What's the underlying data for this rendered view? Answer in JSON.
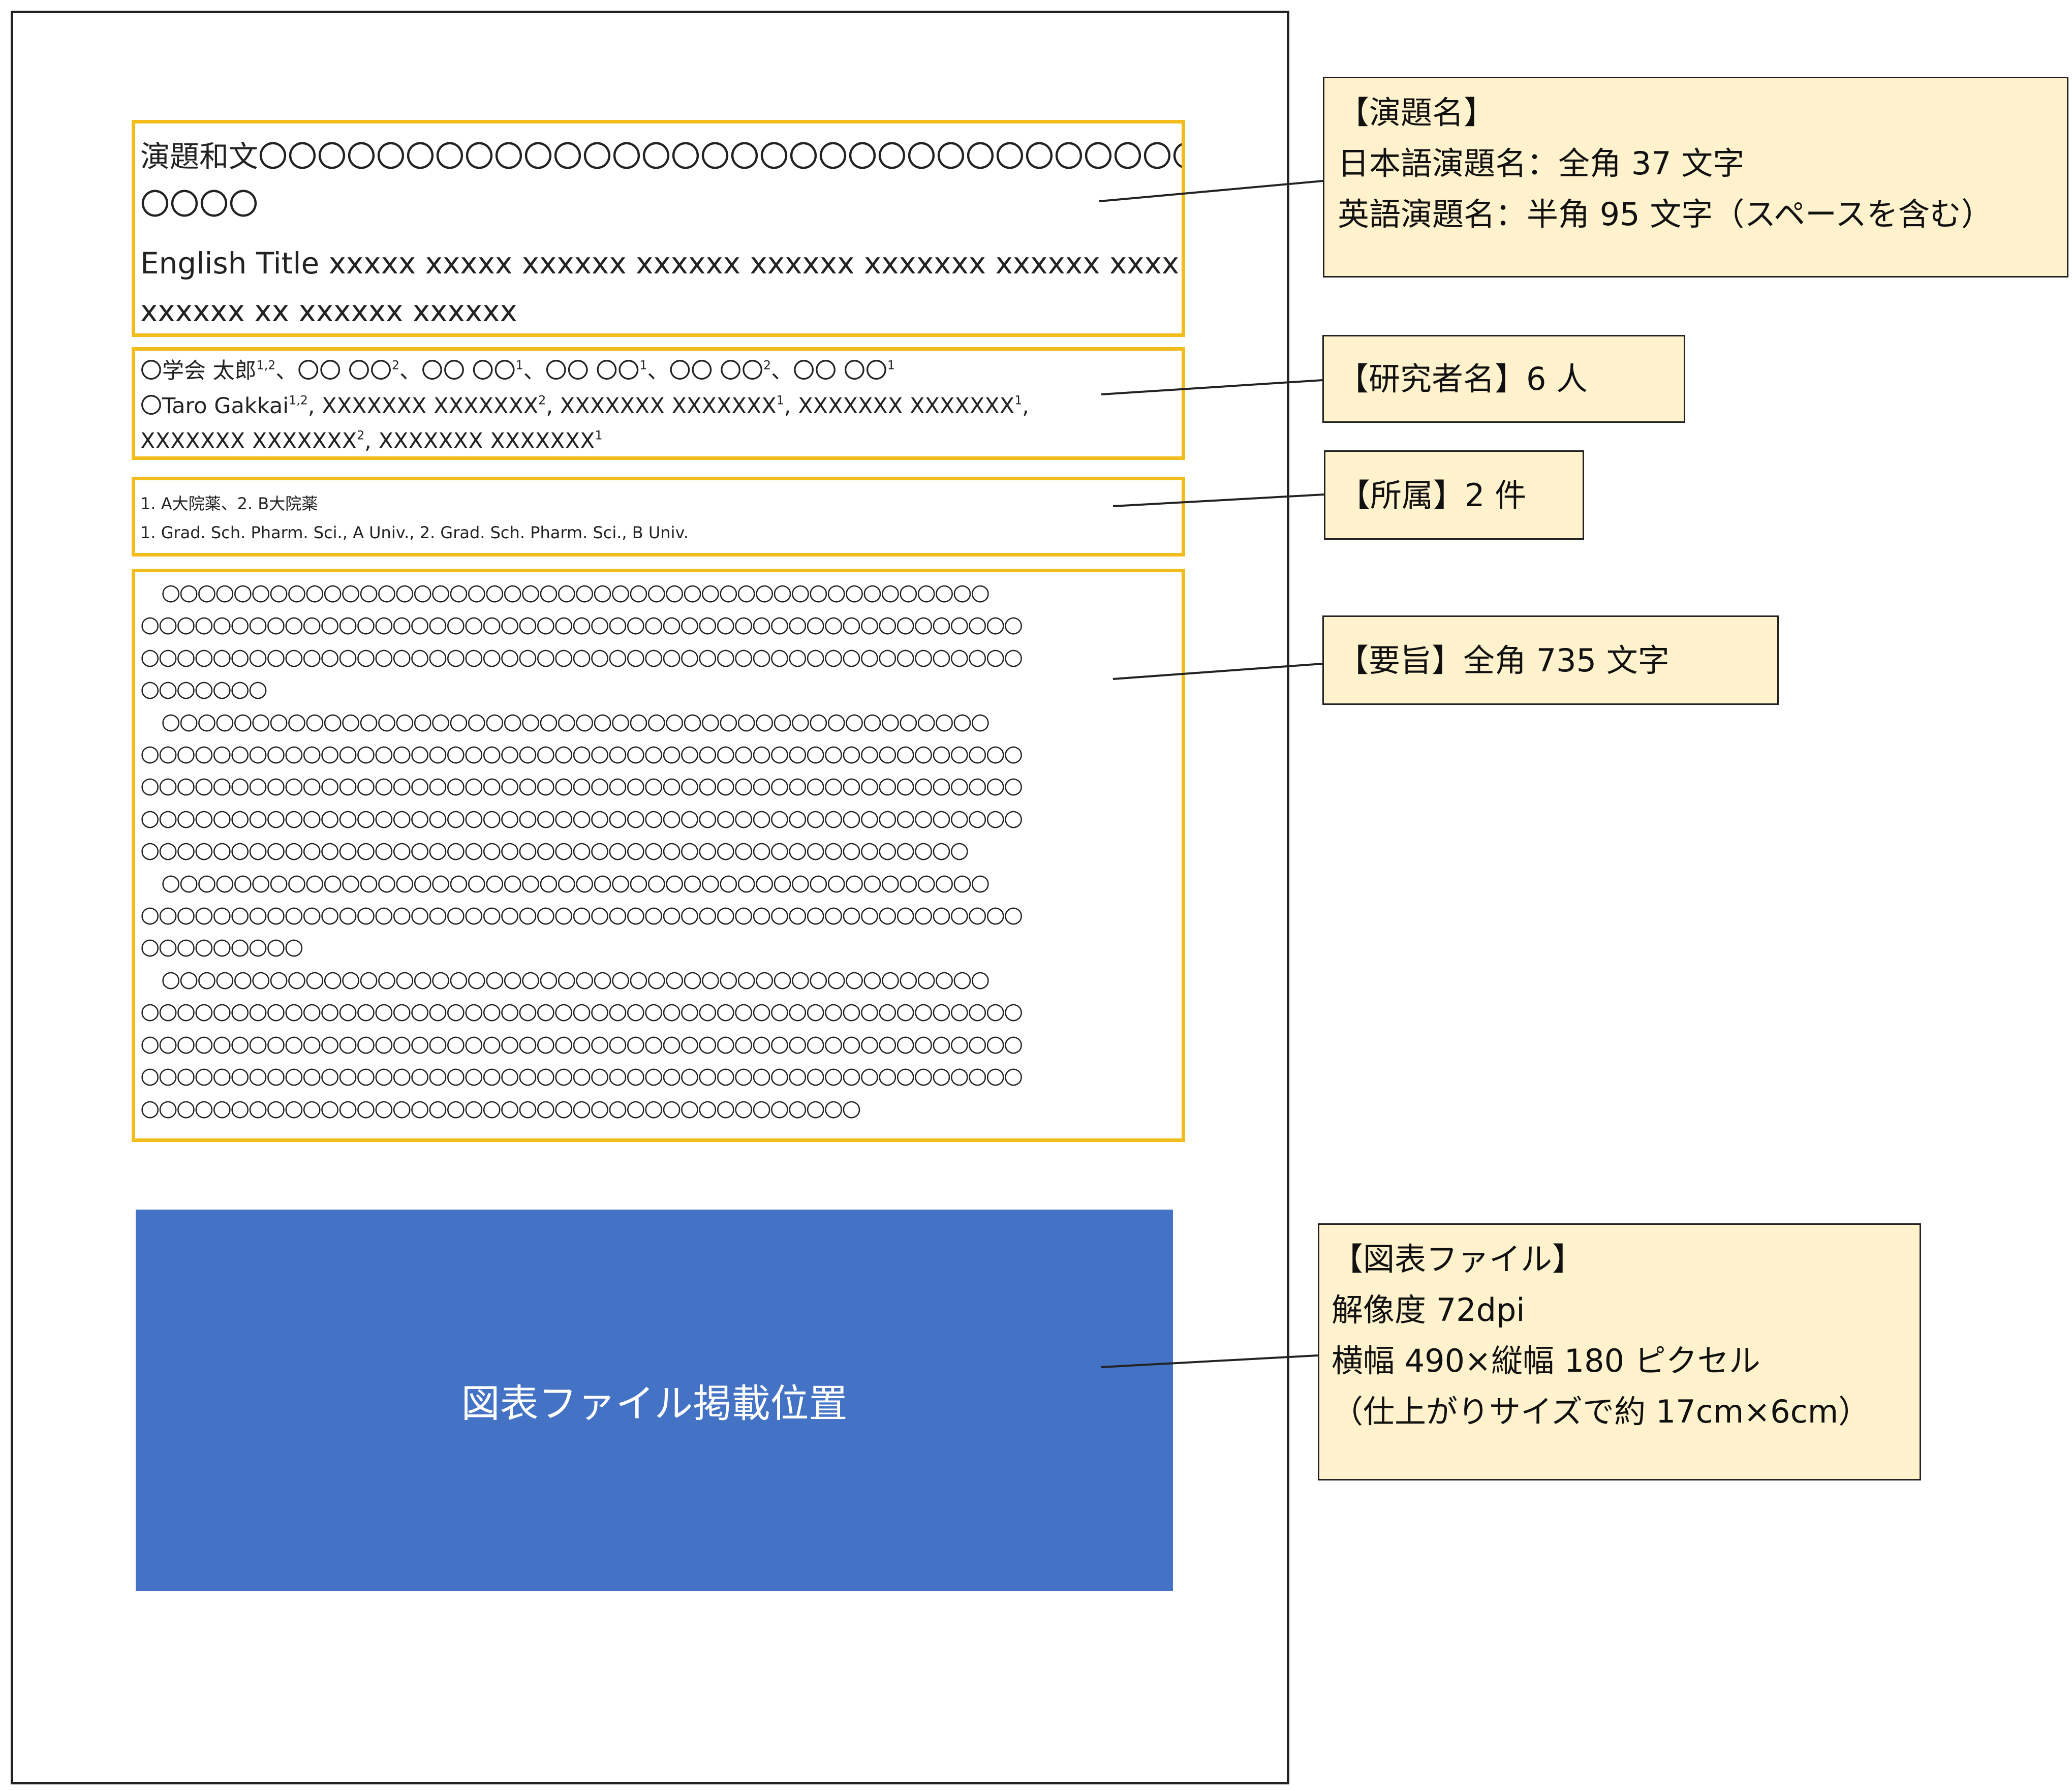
{
  "sections": {
    "title": {
      "jp_lines": [
        "演題和文〇〇〇〇〇〇〇〇〇〇〇〇〇〇〇〇〇〇〇〇〇〇〇〇〇〇〇〇〇〇〇〇〇〇〇",
        "〇〇〇〇"
      ],
      "en_lines": [
        "English Title xxxxx xxxxx xxxxxx xxxxxx xxxxxx xxxxxxx xxxxxx xxxx xxxx",
        "xxxxxx xx xxxxxx xxxxxx"
      ]
    },
    "authors": {
      "jp": {
        "a1": "〇学会 太郎",
        "a1_sup": "1,2",
        "a2": "、〇〇 〇〇",
        "a2_sup": "2",
        "a3": "、〇〇 〇〇",
        "a3_sup": "1",
        "a4": "、〇〇 〇〇",
        "a4_sup": "1",
        "a5": "、〇〇 〇〇",
        "a5_sup": "2",
        "a6": "、〇〇 〇〇",
        "a6_sup": "1"
      },
      "en": {
        "a1": "〇Taro Gakkai",
        "a1_sup": "1,2",
        "a2": ", XXXXXXX XXXXXXX",
        "a2_sup": "2",
        "a3": ", XXXXXXX XXXXXXX",
        "a3_sup": "1",
        "a4": ", XXXXXXX XXXXXXX",
        "a4_sup": "1",
        "a5": "XXXXXXX XXXXXXX",
        "a5_sup": "2",
        "a6": ", XXXXXXX XXXXXXX",
        "a6_sup": "1",
        "line1_end": ","
      }
    },
    "affiliations": {
      "jp": "1. A大院薬、2. B大院薬",
      "en": "1. Grad. Sch. Pharm. Sci., A Univ., 2. Grad. Sch. Pharm. Sci., B Univ."
    },
    "abstract": {
      "paragraph_lines": [
        [
          46,
          49,
          49,
          7
        ],
        [
          46,
          49,
          49,
          49,
          46
        ],
        [
          46,
          49,
          9
        ],
        [
          46,
          49,
          49,
          49,
          40
        ]
      ]
    }
  },
  "figure": {
    "label": "図表ファイル掲載位置",
    "color": "#4472c4"
  },
  "notes": {
    "title": [
      "【演題名】",
      "日本語演題名：全角 37 文字",
      "英語演題名：半角 95 文字（スペースを含む）"
    ],
    "authors": "【研究者名】6 人",
    "affiliation": "【所属】2 件",
    "abstract": "【要旨】全角 735 文字",
    "figure": [
      "【図表ファイル】",
      "解像度 72dpi",
      "横幅 490×縦幅 180 ピクセル",
      "（仕上がりサイズで約 17cm×6cm）"
    ]
  },
  "colors": {
    "section_border": "#f2bc1b",
    "note_fill": "#fff2cc",
    "figure_fill": "#4472c4"
  }
}
